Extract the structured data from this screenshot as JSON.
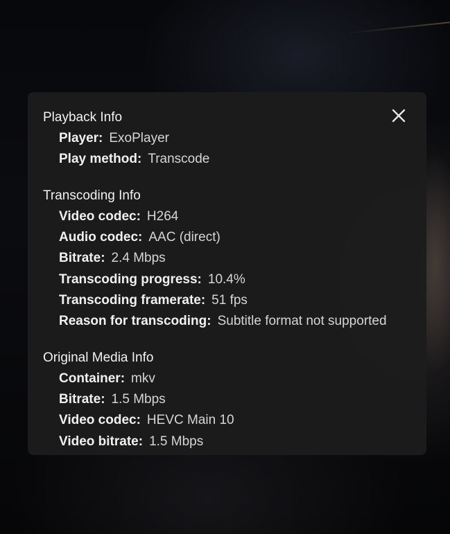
{
  "playback_info": {
    "title": "Playback Info",
    "rows": [
      {
        "label": "Player",
        "value": "ExoPlayer"
      },
      {
        "label": "Play method",
        "value": "Transcode"
      }
    ]
  },
  "transcoding_info": {
    "title": "Transcoding Info",
    "rows": [
      {
        "label": "Video codec",
        "value": "H264"
      },
      {
        "label": "Audio codec",
        "value": "AAC (direct)"
      },
      {
        "label": "Bitrate",
        "value": "2.4 Mbps"
      },
      {
        "label": "Transcoding progress",
        "value": "10.4%"
      },
      {
        "label": "Transcoding framerate",
        "value": "51 fps"
      },
      {
        "label": "Reason for transcoding",
        "value": "Subtitle format not supported"
      }
    ]
  },
  "original_media_info": {
    "title": "Original Media Info",
    "rows": [
      {
        "label": "Container",
        "value": "mkv"
      },
      {
        "label": "Bitrate",
        "value": "1.5 Mbps"
      },
      {
        "label": "Video codec",
        "value": "HEVC Main 10"
      },
      {
        "label": "Video bitrate",
        "value": "1.5 Mbps"
      }
    ]
  },
  "icons": {
    "close": "close-icon"
  },
  "colors": {
    "panel_background": "#1c1c1c",
    "text": "#e8e8e8"
  }
}
